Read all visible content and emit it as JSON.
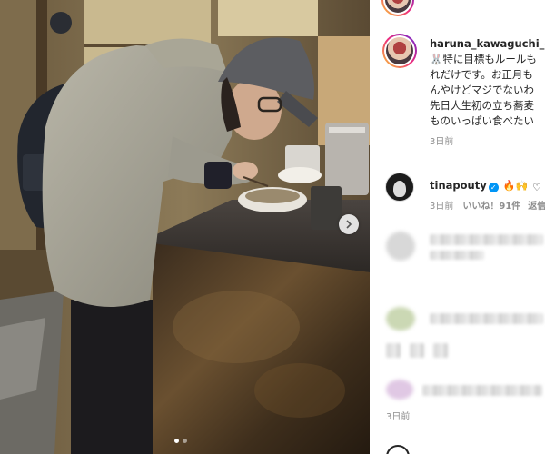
{
  "post": {
    "caption_user": "haruna_kawaguchi_official",
    "caption_lines": [
      "🐰特に目標もルールも",
      "れだけです。お正月も",
      "んやけどマジでないわ",
      "先日人生初の立ち蕎麦",
      "ものいっぱい食べたい"
    ],
    "caption_time": "3日前"
  },
  "comment": {
    "user": "tinapouty",
    "verified_icon": "verified-badge-icon",
    "emojis": "🔥🙌",
    "time": "3日前",
    "likes": "いいね！91件",
    "reply": "返信"
  },
  "blurred_time": "3日前",
  "carousel": {
    "current": 1,
    "total": 2
  },
  "colors": {
    "accent": "#0095f6",
    "muted": "#8e8e8e"
  }
}
